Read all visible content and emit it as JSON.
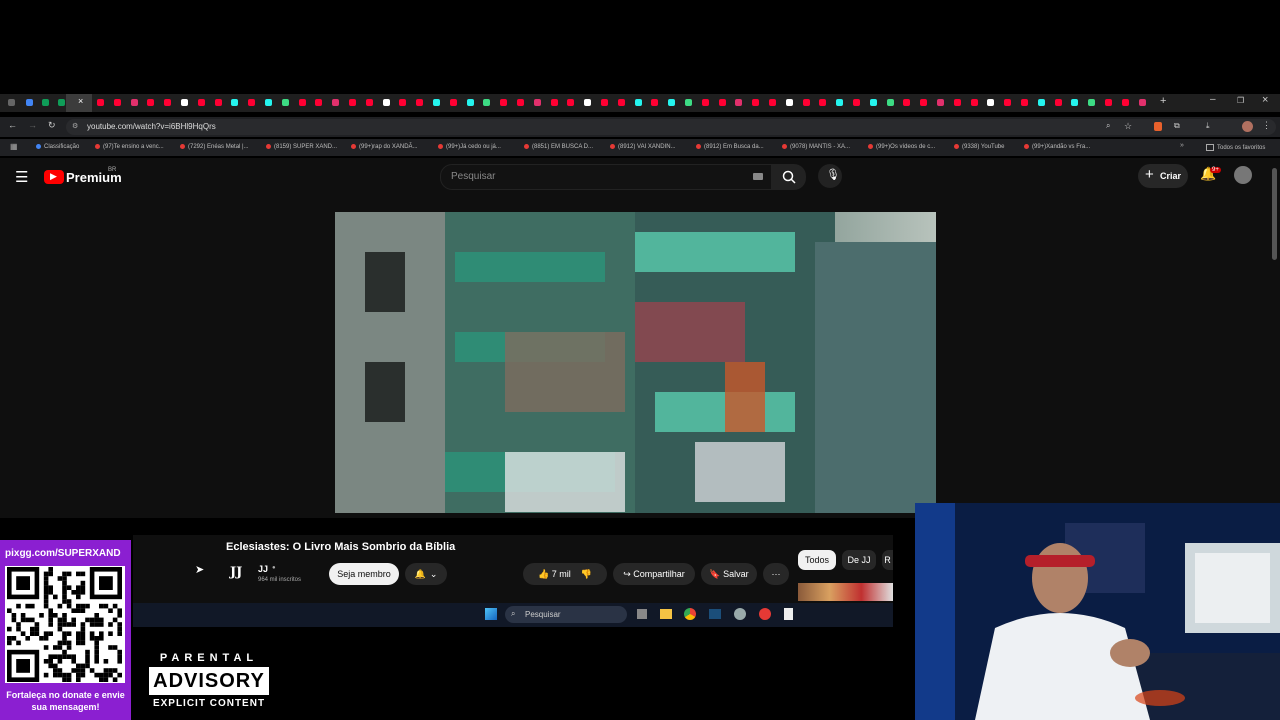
{
  "browser": {
    "url": "youtube.com/watch?v=i6BHl9HqQrs",
    "bookmarks": [
      "Classificação",
      "(97)Te ensino a venc...",
      "(7292) Enéas Metal |...",
      "(8159) SUPER XAND...",
      "(99+)rap do XANDÃ...",
      "(99+)Já cedo ou já...",
      "(8851) EM BUSCA D...",
      "(8912) VAI XANDIN...",
      "(8912) Em Busca da...",
      "(9078) MANTIS - XA...",
      "(99+)Os vídeos de c...",
      "(9338) YouTube",
      "(99+)Xandão vs Fra..."
    ],
    "all_bookmarks": "Todos os favoritos"
  },
  "youtube": {
    "logo": "Premium",
    "logo_region": "BR",
    "search_placeholder": "Pesquisar",
    "create_label": "Criar",
    "notifications": "9+",
    "video_title": "Eclesiastes: O Livro Mais Sombrio da Bíblia",
    "channel_logo": "JJ",
    "channel_name": "JJ",
    "subscribers": "964 mil inscritos",
    "join_label": "Seja membro",
    "likes": "7 mil",
    "share_label": "Compartilhar",
    "save_label": "Salvar",
    "chips": [
      "Todos",
      "De JJ",
      "R"
    ]
  },
  "taskbar": {
    "search_placeholder": "Pesquisar"
  },
  "overlay": {
    "pix_url": "pixgg.com/SUPERXAND",
    "donate_text": "Fortaleça no donate e envie sua mensagem!",
    "advisory_top": "PARENTAL",
    "advisory_mid": "ADVISORY",
    "advisory_bottom": "EXPLICIT CONTENT"
  },
  "colors": {
    "yt_red": "#ff0000",
    "accent_purple": "#8b1fd1",
    "bg_dark": "#0f0f0f"
  }
}
